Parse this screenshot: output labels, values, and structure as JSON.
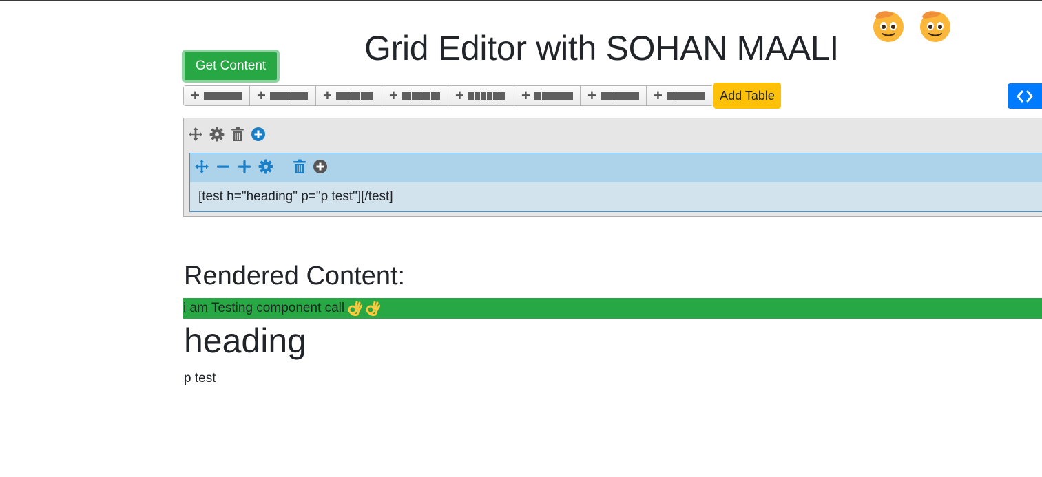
{
  "header": {
    "title": "Grid Editor with SOHAN MAALI",
    "emoji_icon": "saluting-face-emoji"
  },
  "toolbar": {
    "get_content_label": "Get Content",
    "add_table_label": "Add Table",
    "code_view_icon": "code-icon",
    "layout_buttons": [
      {
        "icon": "plus-icon",
        "layout": "12"
      },
      {
        "icon": "plus-icon",
        "layout": "6-6"
      },
      {
        "icon": "plus-icon",
        "layout": "4-4-4"
      },
      {
        "icon": "plus-icon",
        "layout": "3-3-3-3"
      },
      {
        "icon": "plus-icon",
        "layout": "2-2-2-2-2-2"
      },
      {
        "icon": "plus-icon",
        "layout": "4-8"
      },
      {
        "icon": "plus-icon",
        "layout": "8-4"
      },
      {
        "icon": "plus-icon",
        "layout": "9-3"
      }
    ]
  },
  "editor": {
    "row_tools": [
      "move-icon",
      "gear-icon",
      "trash-icon",
      "add-circle-icon"
    ],
    "column_tools": [
      "move-icon",
      "minus-icon",
      "plus-icon",
      "gear-icon",
      "trash-icon",
      "add-circle-icon"
    ],
    "column_content": "[test h=\"heading\" p=\"p test\"][/test]"
  },
  "rendered": {
    "heading": "Rendered Content:",
    "banner_text": "i am Testing component call",
    "banner_emoji": "ok-hand-emoji",
    "component_heading": "heading",
    "component_paragraph": "p test"
  },
  "colors": {
    "success": "#28a745",
    "warning": "#ffc107",
    "primary": "#007bff",
    "column_toolbar": "#acd3ea",
    "icon_blue": "#1a7fc7"
  }
}
